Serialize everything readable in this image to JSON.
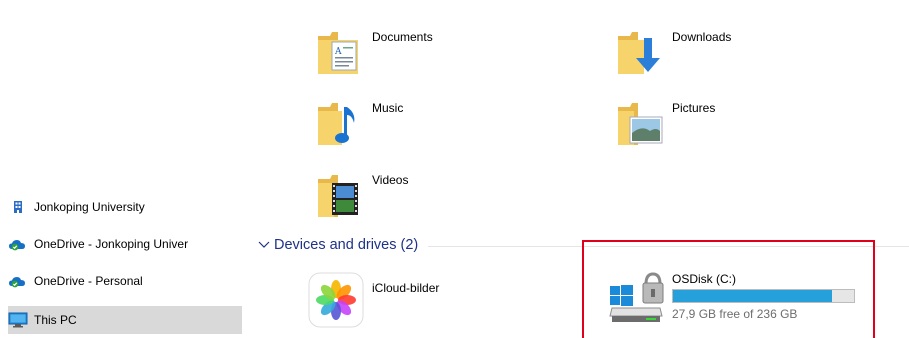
{
  "sidebar": {
    "items": [
      {
        "label": "Jonkoping University",
        "icon": "building-icon"
      },
      {
        "label": "OneDrive - Jonkoping Univer",
        "icon": "onedrive-business-icon"
      },
      {
        "label": "OneDrive - Personal",
        "icon": "onedrive-icon"
      },
      {
        "label": "This PC",
        "icon": "computer-icon",
        "selected": true
      }
    ]
  },
  "folders": [
    {
      "label": "Documents",
      "icon": "documents-folder-icon"
    },
    {
      "label": "Downloads",
      "icon": "downloads-folder-icon"
    },
    {
      "label": "Music",
      "icon": "music-folder-icon"
    },
    {
      "label": "Pictures",
      "icon": "pictures-folder-icon"
    },
    {
      "label": "Videos",
      "icon": "videos-folder-icon"
    }
  ],
  "devices_section": {
    "title": "Devices and drives (2)",
    "expanded": true
  },
  "devices": [
    {
      "label": "iCloud-bilder",
      "icon": "icloud-photos-icon"
    },
    {
      "label": "OSDisk (C:)",
      "icon": "system-drive-icon",
      "free_text": "27,9 GB free of 236 GB",
      "used_fraction": 0.88
    }
  ],
  "colors": {
    "accent": "#26a0da",
    "section_title": "#1e3287",
    "highlight": "#e0001b",
    "selected": "#d9d9d9"
  }
}
